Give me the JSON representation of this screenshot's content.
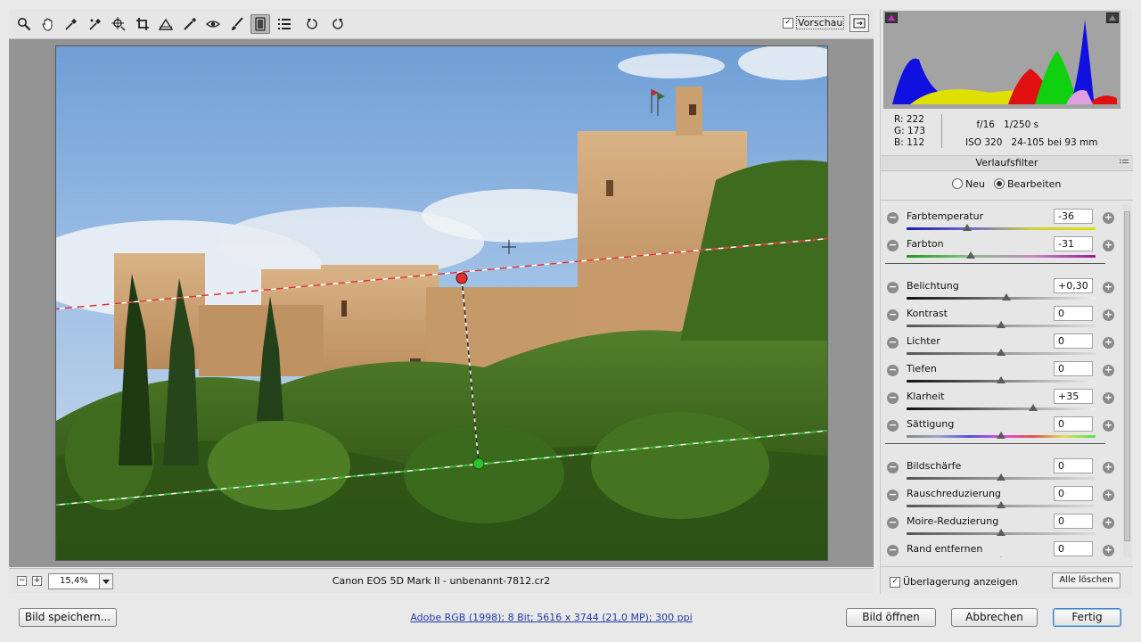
{
  "toolbar": {
    "tools": [
      {
        "name": "zoom-tool",
        "icon": "magnifier-icon"
      },
      {
        "name": "hand-tool",
        "icon": "hand-icon"
      },
      {
        "name": "white-balance-tool",
        "icon": "eyedropper-icon"
      },
      {
        "name": "color-sampler-tool",
        "icon": "color-sampler-icon"
      },
      {
        "name": "targeted-adjustment-tool",
        "icon": "target-adjust-icon"
      },
      {
        "name": "crop-tool",
        "icon": "crop-icon"
      },
      {
        "name": "straighten-tool",
        "icon": "straighten-icon"
      },
      {
        "name": "spot-removal-tool",
        "icon": "spot-removal-icon"
      },
      {
        "name": "red-eye-tool",
        "icon": "red-eye-icon"
      },
      {
        "name": "adjustment-brush-tool",
        "icon": "brush-icon"
      },
      {
        "name": "graduated-filter-tool",
        "icon": "graduated-filter-icon",
        "active": true
      },
      {
        "name": "preferences-tool",
        "icon": "list-icon"
      },
      {
        "name": "rotate-left-tool",
        "icon": "rotate-ccw-icon"
      },
      {
        "name": "rotate-right-tool",
        "icon": "rotate-cw-icon"
      }
    ],
    "preview_label": "Vorschau",
    "preview_checked": true
  },
  "status": {
    "zoom": "15,4%",
    "filename": "Canon EOS 5D Mark II - unbenannt-7812.cr2"
  },
  "panel": {
    "rgb": {
      "r_label": "R:",
      "r": "222",
      "g_label": "G:",
      "g": "173",
      "b_label": "B:",
      "b": "112"
    },
    "exif": {
      "aperture": "f/16",
      "shutter": "1/250 s",
      "iso": "ISO 320",
      "lens": "24-105 bei 93 mm"
    },
    "section_title": "Verlaufsfilter",
    "mode_new": "Neu",
    "mode_edit": "Bearbeiten",
    "sliders": [
      {
        "label": "Farbtemperatur",
        "value": "-36",
        "pos": 0.32,
        "track": "temp"
      },
      {
        "label": "Farbton",
        "value": "-31",
        "pos": 0.34,
        "track": "tint"
      },
      {
        "label": "Belichtung",
        "value": "+0,30",
        "pos": 0.53,
        "track": "dark"
      },
      {
        "label": "Kontrast",
        "value": "0",
        "pos": 0.5,
        "track": "gray"
      },
      {
        "label": "Lichter",
        "value": "0",
        "pos": 0.5,
        "track": "gray"
      },
      {
        "label": "Tiefen",
        "value": "0",
        "pos": 0.5,
        "track": "dark"
      },
      {
        "label": "Klarheit",
        "value": "+35",
        "pos": 0.67,
        "track": "dark"
      },
      {
        "label": "Sättigung",
        "value": "0",
        "pos": 0.5,
        "track": "sat"
      },
      {
        "label": "Bildschärfe",
        "value": "0",
        "pos": 0.5,
        "track": "gray"
      },
      {
        "label": "Rauschreduzierung",
        "value": "0",
        "pos": 0.5,
        "track": "gray"
      },
      {
        "label": "Moire-Reduzierung",
        "value": "0",
        "pos": 0.5,
        "track": "gray"
      },
      {
        "label": "Rand entfernen",
        "value": "0",
        "pos": 0.5,
        "track": "gray"
      }
    ],
    "overlay_label": "Überlagerung anzeigen",
    "overlay_checked": true,
    "clear_all": "Alle löschen"
  },
  "footer": {
    "save": "Bild speichern...",
    "workflow": "Adobe RGB (1998); 8 Bit; 5616 x 3744 (21,0 MP); 300 ppi",
    "open": "Bild öffnen",
    "cancel": "Abbrechen",
    "done": "Fertig"
  },
  "colors": {
    "overlay_start": "#e03030",
    "overlay_end": "#30c030",
    "accent": "#3d7fc3"
  }
}
